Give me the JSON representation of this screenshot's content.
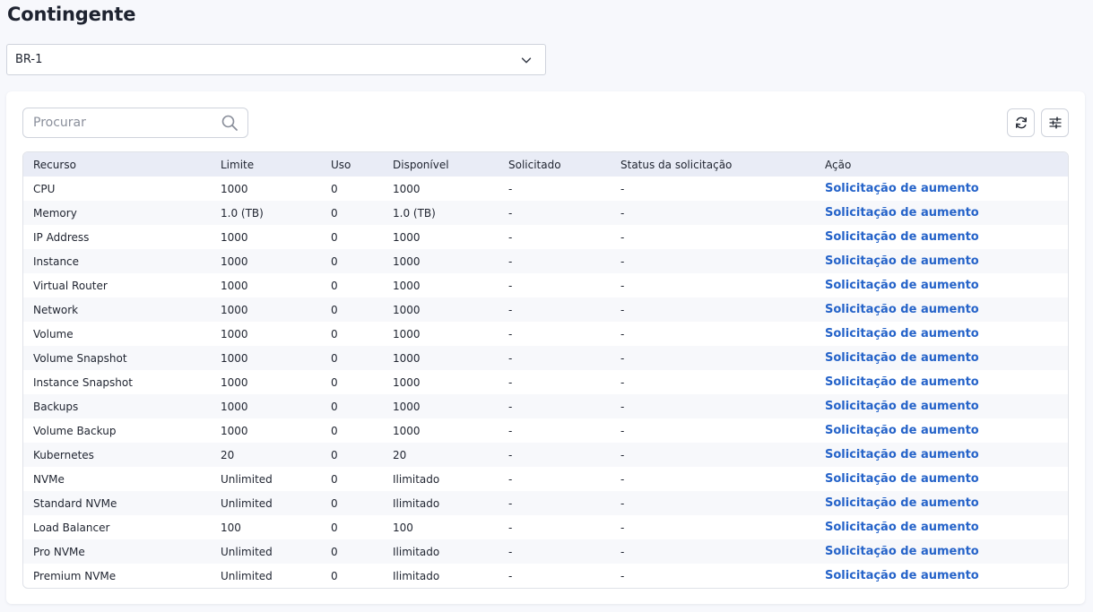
{
  "page": {
    "title": "Contingente"
  },
  "region_select": {
    "value": "BR-1",
    "chevron_icon": "chevron-down-icon"
  },
  "search": {
    "placeholder": "Procurar",
    "icon": "search-icon"
  },
  "toolbar": {
    "refresh_icon": "refresh-icon",
    "filter_icon": "sliders-icon"
  },
  "colors": {
    "accent_link": "#2563c9",
    "header_bg": "#e9ecf6",
    "page_bg": "#f7f8fc"
  },
  "table": {
    "columns": [
      "Recurso",
      "Limite",
      "Uso",
      "Disponível",
      "Solicitado",
      "Status da solicitação",
      "Ação"
    ],
    "rows": [
      {
        "recurso": "CPU",
        "limite": "1000",
        "uso": "0",
        "disponivel": "1000",
        "solicitado": "-",
        "status": "-",
        "acao": "Solicitação de aumento"
      },
      {
        "recurso": "Memory",
        "limite": "1.0 (TB)",
        "uso": "0",
        "disponivel": "1.0 (TB)",
        "solicitado": "-",
        "status": "-",
        "acao": "Solicitação de aumento"
      },
      {
        "recurso": "IP Address",
        "limite": "1000",
        "uso": "0",
        "disponivel": "1000",
        "solicitado": "-",
        "status": "-",
        "acao": "Solicitação de aumento"
      },
      {
        "recurso": "Instance",
        "limite": "1000",
        "uso": "0",
        "disponivel": "1000",
        "solicitado": "-",
        "status": "-",
        "acao": "Solicitação de aumento"
      },
      {
        "recurso": "Virtual Router",
        "limite": "1000",
        "uso": "0",
        "disponivel": "1000",
        "solicitado": "-",
        "status": "-",
        "acao": "Solicitação de aumento"
      },
      {
        "recurso": "Network",
        "limite": "1000",
        "uso": "0",
        "disponivel": "1000",
        "solicitado": "-",
        "status": "-",
        "acao": "Solicitação de aumento"
      },
      {
        "recurso": "Volume",
        "limite": "1000",
        "uso": "0",
        "disponivel": "1000",
        "solicitado": "-",
        "status": "-",
        "acao": "Solicitação de aumento"
      },
      {
        "recurso": "Volume Snapshot",
        "limite": "1000",
        "uso": "0",
        "disponivel": "1000",
        "solicitado": "-",
        "status": "-",
        "acao": "Solicitação de aumento"
      },
      {
        "recurso": "Instance Snapshot",
        "limite": "1000",
        "uso": "0",
        "disponivel": "1000",
        "solicitado": "-",
        "status": "-",
        "acao": "Solicitação de aumento"
      },
      {
        "recurso": "Backups",
        "limite": "1000",
        "uso": "0",
        "disponivel": "1000",
        "solicitado": "-",
        "status": "-",
        "acao": "Solicitação de aumento"
      },
      {
        "recurso": "Volume Backup",
        "limite": "1000",
        "uso": "0",
        "disponivel": "1000",
        "solicitado": "-",
        "status": "-",
        "acao": "Solicitação de aumento"
      },
      {
        "recurso": "Kubernetes",
        "limite": "20",
        "uso": "0",
        "disponivel": "20",
        "solicitado": "-",
        "status": "-",
        "acao": "Solicitação de aumento"
      },
      {
        "recurso": "NVMe",
        "limite": "Unlimited",
        "uso": "0",
        "disponivel": "Ilimitado",
        "solicitado": "-",
        "status": "-",
        "acao": "Solicitação de aumento"
      },
      {
        "recurso": "Standard NVMe",
        "limite": "Unlimited",
        "uso": "0",
        "disponivel": "Ilimitado",
        "solicitado": "-",
        "status": "-",
        "acao": "Solicitação de aumento"
      },
      {
        "recurso": "Load Balancer",
        "limite": "100",
        "uso": "0",
        "disponivel": "100",
        "solicitado": "-",
        "status": "-",
        "acao": "Solicitação de aumento"
      },
      {
        "recurso": "Pro NVMe",
        "limite": "Unlimited",
        "uso": "0",
        "disponivel": "Ilimitado",
        "solicitado": "-",
        "status": "-",
        "acao": "Solicitação de aumento"
      },
      {
        "recurso": "Premium NVMe",
        "limite": "Unlimited",
        "uso": "0",
        "disponivel": "Ilimitado",
        "solicitado": "-",
        "status": "-",
        "acao": "Solicitação de aumento"
      }
    ]
  }
}
